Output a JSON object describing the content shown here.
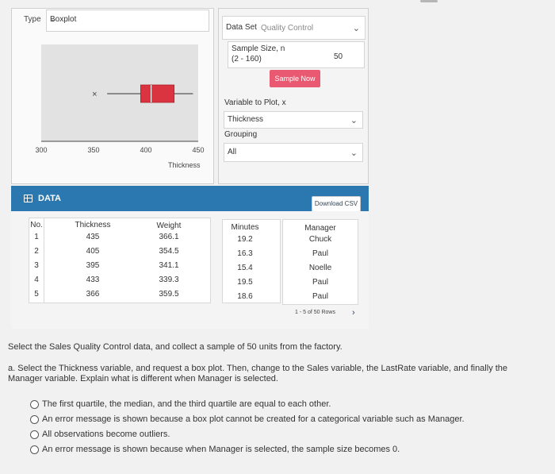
{
  "plot_panel": {
    "type_label": "Type",
    "type_value": "Boxplot",
    "x_ticks": [
      "300",
      "350",
      "400",
      "450"
    ],
    "x_axis_label": "Thickness",
    "outlier_marker": "×",
    "box_color": "#d9343f"
  },
  "chart_data": {
    "type": "boxplot",
    "xlabel": "Thickness",
    "xlim": [
      300,
      450
    ],
    "orientation": "horizontal",
    "outliers": [
      351
    ],
    "whisker_low": 363,
    "q1": 395,
    "median": 405,
    "q3": 427,
    "whisker_high": 445
  },
  "controls": {
    "dataset_label": "Data Set",
    "dataset_placeholder": "Quality Control",
    "sample_size_label": "Sample Size, n",
    "sample_size_range": "(2 - 160)",
    "sample_size_value": "50",
    "sample_button": "Sample Now",
    "variable_label": "Variable to Plot, x",
    "variable_value": "Thickness",
    "grouping_label": "Grouping",
    "grouping_value": "All"
  },
  "data_section": {
    "title": "DATA",
    "download_button": "Download CSV",
    "pager_text": "1 - 5 of 50 Rows",
    "pager_arrow": "›",
    "accent": "#2b78b0",
    "columns": [
      "No.",
      "Thickness",
      "Weight",
      "Minutes",
      "Manager"
    ],
    "rows": [
      [
        "1",
        "435",
        "366.1",
        "19.2",
        "Chuck"
      ],
      [
        "2",
        "405",
        "354.5",
        "16.3",
        "Paul"
      ],
      [
        "3",
        "395",
        "341.1",
        "15.4",
        "Noelle"
      ],
      [
        "4",
        "433",
        "339.3",
        "19.5",
        "Paul"
      ],
      [
        "5",
        "366",
        "359.5",
        "18.6",
        "Paul"
      ]
    ]
  },
  "question": {
    "intro": "Select the Sales Quality Control data, and collect a sample of 50 units from the factory.",
    "part_a": "a. Select the Thickness variable, and request a box plot. Then, change to the Sales variable, the LastRate variable, and finally the Manager variable. Explain what is different when Manager is selected.",
    "options": [
      "The first quartile, the median, and the third quartile are equal to each other.",
      "An error message is shown because a box plot cannot be created for a categorical variable such as Manager.",
      "All observations become outliers.",
      "An error message is shown because when Manager is selected, the sample size becomes 0."
    ]
  }
}
